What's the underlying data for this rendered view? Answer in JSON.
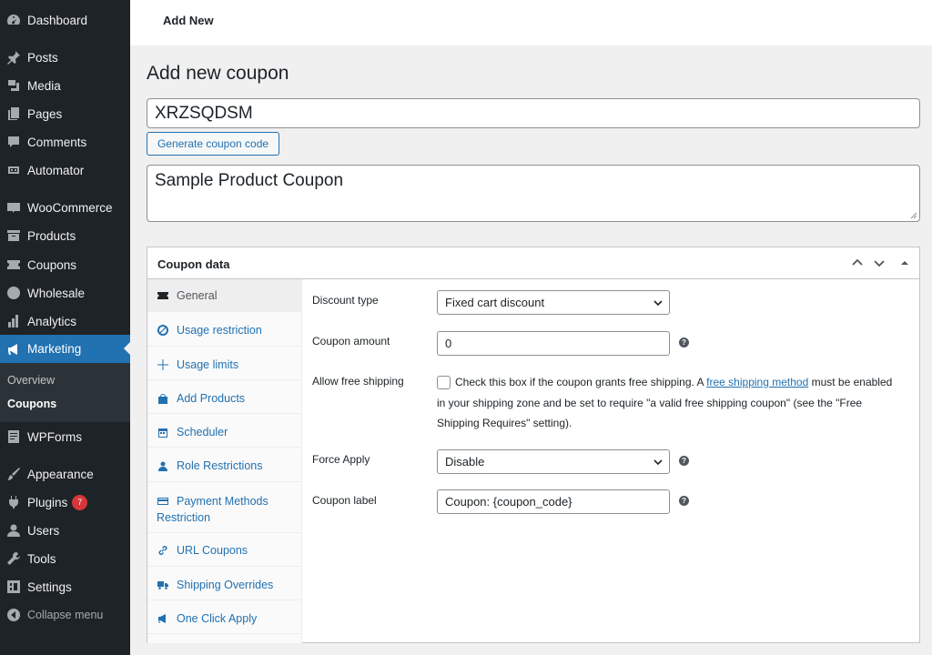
{
  "sidebar": {
    "items": [
      {
        "label": "Dashboard",
        "icon": "dashboard-icon"
      },
      {
        "label": "Posts",
        "icon": "pin-icon"
      },
      {
        "label": "Media",
        "icon": "media-icon"
      },
      {
        "label": "Pages",
        "icon": "pages-icon"
      },
      {
        "label": "Comments",
        "icon": "comments-icon"
      },
      {
        "label": "Automator",
        "icon": "automator-icon"
      },
      {
        "label": "WooCommerce",
        "icon": "woo-icon"
      },
      {
        "label": "Products",
        "icon": "archive-icon"
      },
      {
        "label": "Coupons",
        "icon": "ticket-icon"
      },
      {
        "label": "Wholesale",
        "icon": "wholesale-icon"
      },
      {
        "label": "Analytics",
        "icon": "bar-chart-icon"
      },
      {
        "label": "Marketing",
        "icon": "megaphone-icon",
        "active": true
      },
      {
        "label": "WPForms",
        "icon": "forms-icon"
      },
      {
        "label": "Appearance",
        "icon": "brush-icon"
      },
      {
        "label": "Plugins",
        "icon": "plug-icon",
        "badge": "7"
      },
      {
        "label": "Users",
        "icon": "user-icon"
      },
      {
        "label": "Tools",
        "icon": "wrench-icon"
      },
      {
        "label": "Settings",
        "icon": "settings-icon"
      },
      {
        "label": "Collapse menu",
        "icon": "collapse-icon"
      }
    ],
    "submenu": [
      "Overview",
      "Coupons"
    ]
  },
  "topbar": {
    "title": "Add New"
  },
  "page": {
    "title": "Add new coupon",
    "coupon_code": "XRZSQDSM",
    "generate_label": "Generate coupon code",
    "description": "Sample Product Coupon"
  },
  "panel": {
    "title": "Coupon data",
    "tabs": [
      "General",
      "Usage restriction",
      "Usage limits",
      "Add Products",
      "Scheduler",
      "Role Restrictions",
      "Payment Methods Restriction",
      "URL Coupons",
      "Shipping Overrides",
      "One Click Apply"
    ],
    "fields": {
      "discount_type_label": "Discount type",
      "discount_type_value": "Fixed cart discount",
      "amount_label": "Coupon amount",
      "amount_value": "0",
      "free_shipping_label": "Allow free shipping",
      "free_shipping_pre": "Check this box if the coupon grants free shipping. A ",
      "free_shipping_link": "free shipping method",
      "free_shipping_post": " must be enabled in your shipping zone and be set to require \"a valid free shipping coupon\" (see the \"Free Shipping Requires\" setting).",
      "force_apply_label": "Force Apply",
      "force_apply_value": "Disable",
      "coupon_label_label": "Coupon label",
      "coupon_label_value": "Coupon: {coupon_code}"
    }
  },
  "colors": {
    "accent": "#2271b1",
    "sidebar_bg": "#1d2327",
    "badge": "#d63638"
  }
}
